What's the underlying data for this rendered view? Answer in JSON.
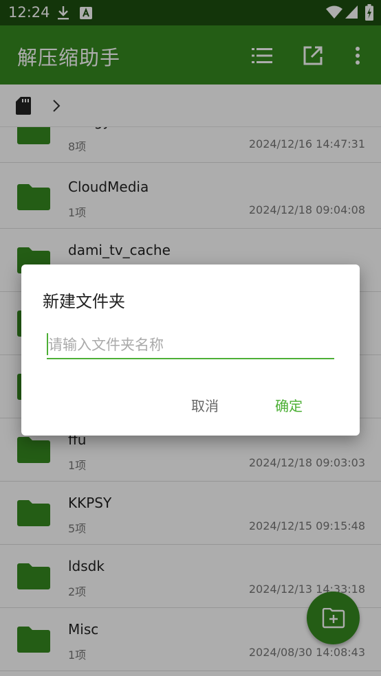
{
  "status": {
    "time": "12:24"
  },
  "app_bar": {
    "title": "解压缩助手",
    "color": "#358a20"
  },
  "files": [
    {
      "name": "bangy",
      "count": "8项",
      "date": "2024/12/16 14:47:31"
    },
    {
      "name": "CloudMedia",
      "count": "1项",
      "date": "2024/12/18 09:04:08"
    },
    {
      "name": "dami_tv_cache",
      "count": "",
      "date": ""
    },
    {
      "name": "",
      "count": "",
      "date": ""
    },
    {
      "name": "",
      "count": "",
      "date": ""
    },
    {
      "name": "ffu",
      "count": "1项",
      "date": "2024/12/18 09:03:03"
    },
    {
      "name": "KKPSY",
      "count": "5项",
      "date": "2024/12/15 09:15:48"
    },
    {
      "name": "ldsdk",
      "count": "2项",
      "date": "2024/12/13 14:33:18"
    },
    {
      "name": "Misc",
      "count": "1项",
      "date": "2024/08/30 14:08:43"
    }
  ],
  "dialog": {
    "title": "新建文件夹",
    "input_value": "",
    "input_placeholder": "请输入文件夹名称",
    "cancel_label": "取消",
    "ok_label": "确定",
    "accent": "#4caf35"
  }
}
